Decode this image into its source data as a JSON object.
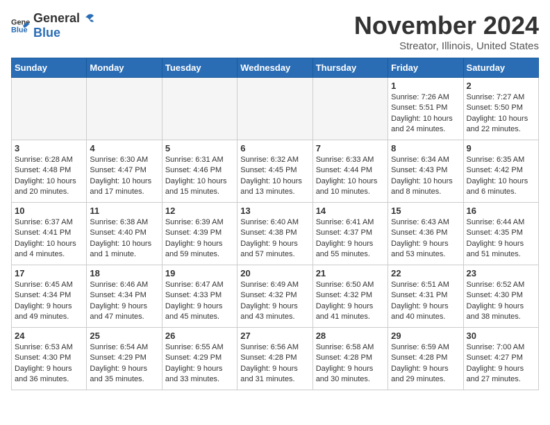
{
  "header": {
    "logo_general": "General",
    "logo_blue": "Blue",
    "month_title": "November 2024",
    "location": "Streator, Illinois, United States"
  },
  "weekdays": [
    "Sunday",
    "Monday",
    "Tuesday",
    "Wednesday",
    "Thursday",
    "Friday",
    "Saturday"
  ],
  "weeks": [
    [
      {
        "day": "",
        "empty": true
      },
      {
        "day": "",
        "empty": true
      },
      {
        "day": "",
        "empty": true
      },
      {
        "day": "",
        "empty": true
      },
      {
        "day": "",
        "empty": true
      },
      {
        "day": "1",
        "sunrise": "Sunrise: 7:26 AM",
        "sunset": "Sunset: 5:51 PM",
        "daylight": "Daylight: 10 hours and 24 minutes."
      },
      {
        "day": "2",
        "sunrise": "Sunrise: 7:27 AM",
        "sunset": "Sunset: 5:50 PM",
        "daylight": "Daylight: 10 hours and 22 minutes."
      }
    ],
    [
      {
        "day": "3",
        "sunrise": "Sunrise: 6:28 AM",
        "sunset": "Sunset: 4:48 PM",
        "daylight": "Daylight: 10 hours and 20 minutes."
      },
      {
        "day": "4",
        "sunrise": "Sunrise: 6:30 AM",
        "sunset": "Sunset: 4:47 PM",
        "daylight": "Daylight: 10 hours and 17 minutes."
      },
      {
        "day": "5",
        "sunrise": "Sunrise: 6:31 AM",
        "sunset": "Sunset: 4:46 PM",
        "daylight": "Daylight: 10 hours and 15 minutes."
      },
      {
        "day": "6",
        "sunrise": "Sunrise: 6:32 AM",
        "sunset": "Sunset: 4:45 PM",
        "daylight": "Daylight: 10 hours and 13 minutes."
      },
      {
        "day": "7",
        "sunrise": "Sunrise: 6:33 AM",
        "sunset": "Sunset: 4:44 PM",
        "daylight": "Daylight: 10 hours and 10 minutes."
      },
      {
        "day": "8",
        "sunrise": "Sunrise: 6:34 AM",
        "sunset": "Sunset: 4:43 PM",
        "daylight": "Daylight: 10 hours and 8 minutes."
      },
      {
        "day": "9",
        "sunrise": "Sunrise: 6:35 AM",
        "sunset": "Sunset: 4:42 PM",
        "daylight": "Daylight: 10 hours and 6 minutes."
      }
    ],
    [
      {
        "day": "10",
        "sunrise": "Sunrise: 6:37 AM",
        "sunset": "Sunset: 4:41 PM",
        "daylight": "Daylight: 10 hours and 4 minutes."
      },
      {
        "day": "11",
        "sunrise": "Sunrise: 6:38 AM",
        "sunset": "Sunset: 4:40 PM",
        "daylight": "Daylight: 10 hours and 1 minute."
      },
      {
        "day": "12",
        "sunrise": "Sunrise: 6:39 AM",
        "sunset": "Sunset: 4:39 PM",
        "daylight": "Daylight: 9 hours and 59 minutes."
      },
      {
        "day": "13",
        "sunrise": "Sunrise: 6:40 AM",
        "sunset": "Sunset: 4:38 PM",
        "daylight": "Daylight: 9 hours and 57 minutes."
      },
      {
        "day": "14",
        "sunrise": "Sunrise: 6:41 AM",
        "sunset": "Sunset: 4:37 PM",
        "daylight": "Daylight: 9 hours and 55 minutes."
      },
      {
        "day": "15",
        "sunrise": "Sunrise: 6:43 AM",
        "sunset": "Sunset: 4:36 PM",
        "daylight": "Daylight: 9 hours and 53 minutes."
      },
      {
        "day": "16",
        "sunrise": "Sunrise: 6:44 AM",
        "sunset": "Sunset: 4:35 PM",
        "daylight": "Daylight: 9 hours and 51 minutes."
      }
    ],
    [
      {
        "day": "17",
        "sunrise": "Sunrise: 6:45 AM",
        "sunset": "Sunset: 4:34 PM",
        "daylight": "Daylight: 9 hours and 49 minutes."
      },
      {
        "day": "18",
        "sunrise": "Sunrise: 6:46 AM",
        "sunset": "Sunset: 4:34 PM",
        "daylight": "Daylight: 9 hours and 47 minutes."
      },
      {
        "day": "19",
        "sunrise": "Sunrise: 6:47 AM",
        "sunset": "Sunset: 4:33 PM",
        "daylight": "Daylight: 9 hours and 45 minutes."
      },
      {
        "day": "20",
        "sunrise": "Sunrise: 6:49 AM",
        "sunset": "Sunset: 4:32 PM",
        "daylight": "Daylight: 9 hours and 43 minutes."
      },
      {
        "day": "21",
        "sunrise": "Sunrise: 6:50 AM",
        "sunset": "Sunset: 4:32 PM",
        "daylight": "Daylight: 9 hours and 41 minutes."
      },
      {
        "day": "22",
        "sunrise": "Sunrise: 6:51 AM",
        "sunset": "Sunset: 4:31 PM",
        "daylight": "Daylight: 9 hours and 40 minutes."
      },
      {
        "day": "23",
        "sunrise": "Sunrise: 6:52 AM",
        "sunset": "Sunset: 4:30 PM",
        "daylight": "Daylight: 9 hours and 38 minutes."
      }
    ],
    [
      {
        "day": "24",
        "sunrise": "Sunrise: 6:53 AM",
        "sunset": "Sunset: 4:30 PM",
        "daylight": "Daylight: 9 hours and 36 minutes."
      },
      {
        "day": "25",
        "sunrise": "Sunrise: 6:54 AM",
        "sunset": "Sunset: 4:29 PM",
        "daylight": "Daylight: 9 hours and 35 minutes."
      },
      {
        "day": "26",
        "sunrise": "Sunrise: 6:55 AM",
        "sunset": "Sunset: 4:29 PM",
        "daylight": "Daylight: 9 hours and 33 minutes."
      },
      {
        "day": "27",
        "sunrise": "Sunrise: 6:56 AM",
        "sunset": "Sunset: 4:28 PM",
        "daylight": "Daylight: 9 hours and 31 minutes."
      },
      {
        "day": "28",
        "sunrise": "Sunrise: 6:58 AM",
        "sunset": "Sunset: 4:28 PM",
        "daylight": "Daylight: 9 hours and 30 minutes."
      },
      {
        "day": "29",
        "sunrise": "Sunrise: 6:59 AM",
        "sunset": "Sunset: 4:28 PM",
        "daylight": "Daylight: 9 hours and 29 minutes."
      },
      {
        "day": "30",
        "sunrise": "Sunrise: 7:00 AM",
        "sunset": "Sunset: 4:27 PM",
        "daylight": "Daylight: 9 hours and 27 minutes."
      }
    ]
  ]
}
